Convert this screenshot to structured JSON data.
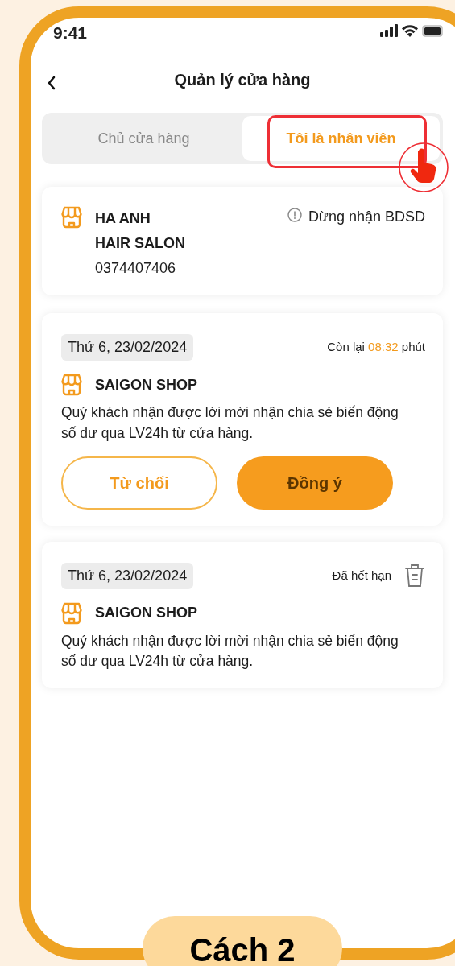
{
  "status_bar": {
    "time": "9:41"
  },
  "header": {
    "title": "Quản lý cửa hàng"
  },
  "tabs": [
    {
      "label": "Chủ cửa hàng",
      "selected": false,
      "highlighted": false
    },
    {
      "label": "Tôi là nhân viên",
      "selected": true,
      "highlighted": true
    }
  ],
  "store": {
    "name_lines": [
      "HA ANH",
      "HAIR SALON"
    ],
    "phone": "0374407406",
    "action": "Dừng nhận BDSD"
  },
  "invitations": [
    {
      "kind": "pending",
      "date": "Thứ 6, 23/02/2024",
      "status_prefix": "Còn lại",
      "countdown": "08:32",
      "status_suffix": "phút",
      "shop": "SAIGON SHOP",
      "message": "Quý khách nhận được lời mời nhận chia sẻ biến động số dư qua LV24h từ cửa hàng.",
      "buttons": [
        {
          "label": "Từ chối",
          "kind": "outline"
        },
        {
          "label": "Đồng ý",
          "kind": "primary"
        }
      ]
    },
    {
      "kind": "expired",
      "date": "Thứ 6, 23/02/2024",
      "status": "Đã hết hạn",
      "shop": "SAIGON SHOP",
      "message": "Quý khách nhận được lời mời nhận chia sẻ biến động số dư qua LV24h từ cửa hàng."
    }
  ],
  "caption": "Cách 2"
}
